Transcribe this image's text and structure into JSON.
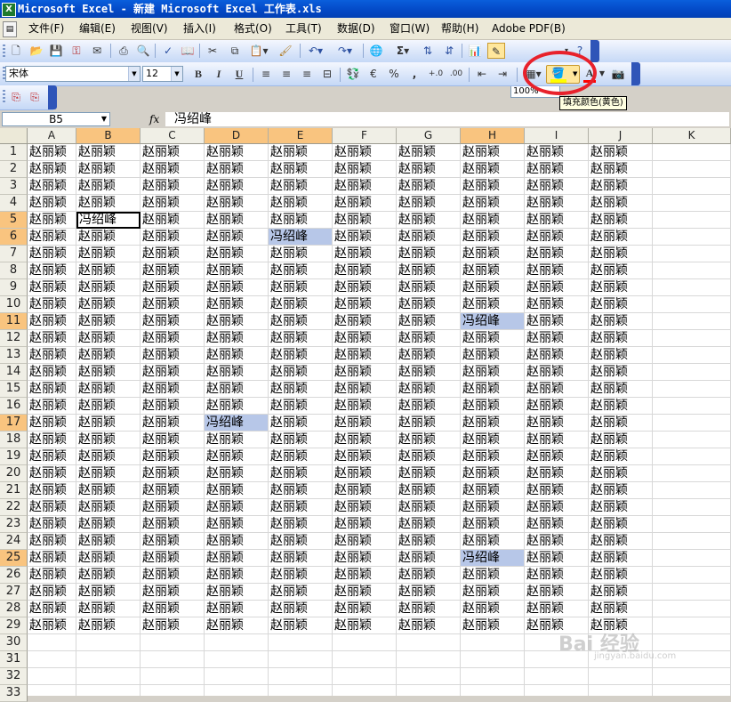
{
  "window": {
    "title": "Microsoft Excel - 新建 Microsoft Excel 工作表.xls",
    "app_icon": "X"
  },
  "menubar": {
    "items": [
      "文件(F)",
      "编辑(E)",
      "视图(V)",
      "插入(I)",
      "格式(O)",
      "工具(T)",
      "数据(D)",
      "窗口(W)",
      "帮助(H)",
      "Adobe PDF(B)"
    ]
  },
  "standard_toolbar": {
    "zoom": "100%",
    "sigma": "Σ"
  },
  "format_toolbar": {
    "font_name": "宋体",
    "font_size": "12",
    "bold": "B",
    "italic": "I",
    "underline": "U",
    "percent": "%",
    "comma": ",",
    "font_color_glyph": "A",
    "fill_color_hex": "#ffff00",
    "font_color_hex": "#ff0000",
    "highlight_circle_color": "#e8212b"
  },
  "tooltip": "填充颜色(黄色)",
  "formula_bar": {
    "name_box": "B5",
    "fx": "fx",
    "formula": "冯绍峰"
  },
  "sheet": {
    "columns": [
      "A",
      "B",
      "C",
      "D",
      "E",
      "F",
      "G",
      "H",
      "I",
      "J",
      "K"
    ],
    "selected_columns": [
      "B",
      "D",
      "E",
      "H"
    ],
    "rows": [
      "1",
      "2",
      "3",
      "4",
      "5",
      "6",
      "7",
      "8",
      "9",
      "10",
      "11",
      "12",
      "13",
      "14",
      "15",
      "16",
      "17",
      "18",
      "19",
      "20",
      "21",
      "22",
      "23",
      "24",
      "25",
      "26",
      "27",
      "28",
      "29",
      "30",
      "31",
      "32",
      "33"
    ],
    "selected_rows": [
      "5",
      "6",
      "11",
      "17",
      "25"
    ],
    "filled_rows": 29,
    "filled_columns": [
      "A",
      "B",
      "C",
      "D",
      "E",
      "F",
      "G",
      "H",
      "I",
      "J"
    ],
    "default_text": "赵丽颖",
    "special_text": "冯绍峰",
    "active_cell": "B5",
    "special_cells": [
      "B5",
      "E6",
      "H11",
      "D17",
      "H25"
    ],
    "highlight_color": "#b7c7e8"
  },
  "watermark": {
    "text": "Bai 经验",
    "sub": "jingyan.baidu.com"
  }
}
